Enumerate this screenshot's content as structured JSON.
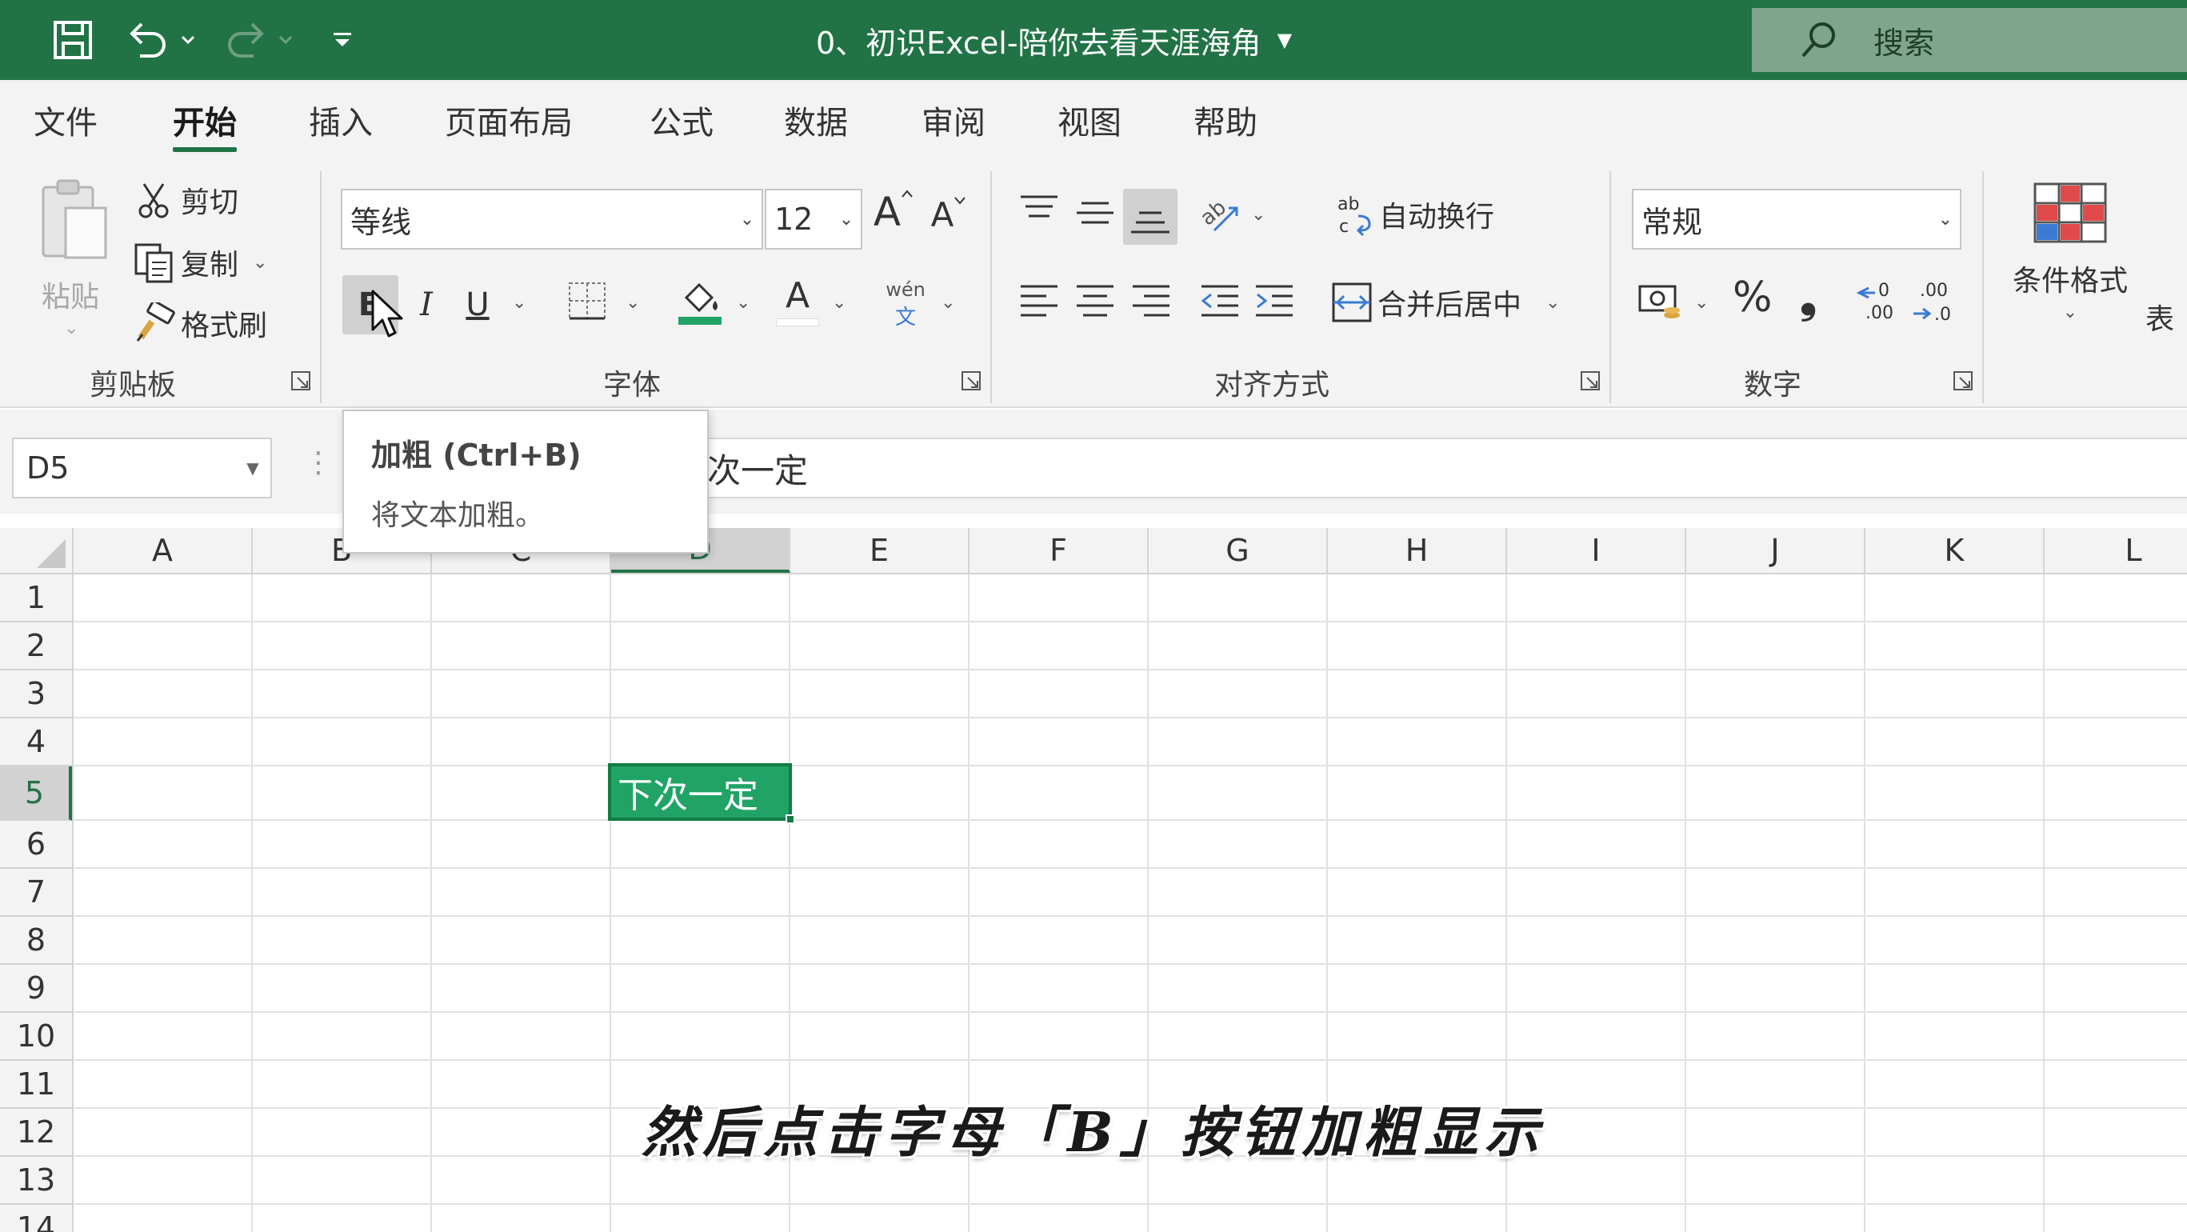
{
  "window": {
    "title": "0、初识Excel-陪你去看天涯海角",
    "search_placeholder": "搜索",
    "accent": "#217346"
  },
  "tabs": [
    {
      "label": "文件",
      "active": false
    },
    {
      "label": "开始",
      "active": true
    },
    {
      "label": "插入",
      "active": false
    },
    {
      "label": "页面布局",
      "active": false
    },
    {
      "label": "公式",
      "active": false
    },
    {
      "label": "数据",
      "active": false
    },
    {
      "label": "审阅",
      "active": false
    },
    {
      "label": "视图",
      "active": false
    },
    {
      "label": "帮助",
      "active": false
    }
  ],
  "ribbon": {
    "clipboard": {
      "label": "剪贴板",
      "paste": "粘贴",
      "cut": "剪切",
      "copy": "复制",
      "format_painter": "格式刷"
    },
    "font": {
      "label": "字体",
      "font_name": "等线",
      "font_size": "12",
      "phonetic_top": "wén",
      "phonetic_bottom": "文",
      "font_color_glyph": "A",
      "grow_glyph": "A",
      "shrink_glyph": "A",
      "bold_glyph": "B",
      "italic_glyph": "I",
      "underline_glyph": "U"
    },
    "alignment": {
      "label": "对齐方式",
      "wrap_text": "自动换行",
      "merge_center": "合并后居中"
    },
    "number": {
      "label": "数字",
      "format": "常规",
      "percent": "%",
      "comma": "❟"
    },
    "styles": {
      "conditional_format": "条件格式",
      "table_partial": "表"
    }
  },
  "formula_bar": {
    "name_box": "D5",
    "content": "下次一定",
    "visible_content": "次一定"
  },
  "grid": {
    "columns": [
      "A",
      "B",
      "C",
      "D",
      "E",
      "F",
      "G",
      "H",
      "I",
      "J",
      "K",
      "L"
    ],
    "rows": [
      "1",
      "2",
      "3",
      "4",
      "5",
      "6",
      "7",
      "8",
      "9",
      "10",
      "11",
      "12",
      "13",
      "14"
    ],
    "selected_column": "D",
    "selected_row": "5",
    "active_cell_value": "下次一定"
  },
  "tooltip": {
    "title": "加粗 (Ctrl+B)",
    "description": "将文本加粗。"
  },
  "subtitle": "然后点击字母「B」按钮加粗显示"
}
